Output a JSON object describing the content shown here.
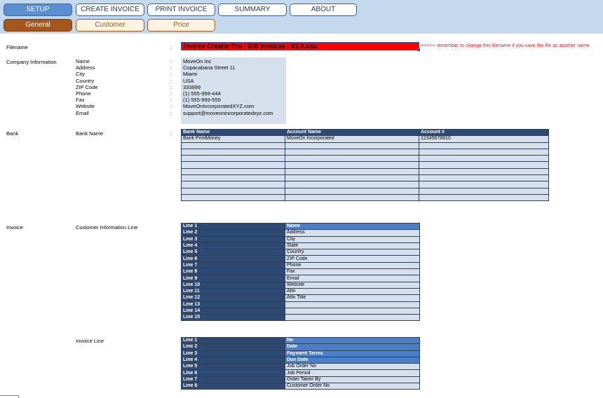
{
  "nav": {
    "main_tabs": [
      {
        "label": "SETUP",
        "active": true
      },
      {
        "label": "CREATE INVOICE",
        "active": false
      },
      {
        "label": "PRINT INVOICE",
        "active": false
      },
      {
        "label": "SUMMARY",
        "active": false
      },
      {
        "label": "ABOUT",
        "active": false
      }
    ],
    "sub_tabs": [
      {
        "label": "General",
        "active": true
      },
      {
        "label": "Customer",
        "active": false
      },
      {
        "label": "Price",
        "active": false
      }
    ]
  },
  "colon": ":",
  "filename": {
    "label": "Filename",
    "value": "Invoice Creator Pro - 600 Invoices - V2.9.xlsx",
    "note": "<<<<< remember to change this filename if you save the file as another name"
  },
  "company": {
    "section_label": "Company Information",
    "fields": [
      {
        "label": "Name",
        "value": "MoveOn Inc"
      },
      {
        "label": "Address",
        "value": "Copacabana Street 11"
      },
      {
        "label": "City",
        "value": "Miami"
      },
      {
        "label": "Country",
        "value": "USA"
      },
      {
        "label": "ZIP Code",
        "value": "333999"
      },
      {
        "label": "Phone",
        "value": "(1) 555-999-444"
      },
      {
        "label": "Fax",
        "value": "(1) 555-999-555"
      },
      {
        "label": "Website",
        "value": "MoveOnIncorporatedXYZ.com"
      },
      {
        "label": "Email",
        "value": "support@moveonincorporatedxyz.com"
      }
    ]
  },
  "bank": {
    "section_label": "Bank",
    "sub_label": "Bank Name",
    "headers": [
      "Bank Name",
      "Account Name",
      "Account #"
    ],
    "rows": [
      [
        "Bank PrintMoney",
        "MoveOn Incorporated",
        "12345678910"
      ],
      [
        "",
        "",
        ""
      ],
      [
        "",
        "",
        ""
      ],
      [
        "",
        "",
        ""
      ],
      [
        "",
        "",
        ""
      ],
      [
        "",
        "",
        ""
      ],
      [
        "",
        "",
        ""
      ],
      [
        "",
        "",
        ""
      ],
      [
        "",
        "",
        ""
      ],
      [
        "",
        "",
        ""
      ]
    ]
  },
  "invoice": {
    "section_label": "Invoice",
    "customer_line": {
      "label": "Customer Information Line",
      "rows": [
        {
          "line": "Line 1",
          "value": "Name",
          "highlight": true
        },
        {
          "line": "Line 2",
          "value": "Address",
          "highlight": false
        },
        {
          "line": "Line 3",
          "value": "City",
          "highlight": false
        },
        {
          "line": "Line 4",
          "value": "State",
          "highlight": false
        },
        {
          "line": "Line 5",
          "value": "Country",
          "highlight": false
        },
        {
          "line": "Line 6",
          "value": "ZIP Code",
          "highlight": false
        },
        {
          "line": "Line 7",
          "value": "Phone",
          "highlight": false
        },
        {
          "line": "Line 8",
          "value": "Fax",
          "highlight": false
        },
        {
          "line": "Line 9",
          "value": "Email",
          "highlight": false
        },
        {
          "line": "Line 10",
          "value": "Website",
          "highlight": false
        },
        {
          "line": "Line 11",
          "value": "Attn",
          "highlight": false
        },
        {
          "line": "Line 12",
          "value": "Attn Title",
          "highlight": false
        },
        {
          "line": "Line 13",
          "value": "",
          "highlight": false
        },
        {
          "line": "Line 14",
          "value": "",
          "highlight": false
        },
        {
          "line": "Line 15",
          "value": "",
          "highlight": false
        }
      ]
    },
    "invoice_line": {
      "label": "Invoice Line",
      "rows": [
        {
          "line": "Line 1",
          "value": "No",
          "highlight": true
        },
        {
          "line": "Line 2",
          "value": "Date",
          "highlight": true
        },
        {
          "line": "Line 3",
          "value": "Payment Terms",
          "highlight": true
        },
        {
          "line": "Line 4",
          "value": "Due Date",
          "highlight": true
        },
        {
          "line": "Line 5",
          "value": "Job Order No",
          "highlight": false
        },
        {
          "line": "Line 6",
          "value": "Job Period",
          "highlight": false
        },
        {
          "line": "Line 7",
          "value": "Order Taken By",
          "highlight": false
        },
        {
          "line": "Line 8",
          "value": "Customer Order No",
          "highlight": false
        }
      ]
    }
  }
}
